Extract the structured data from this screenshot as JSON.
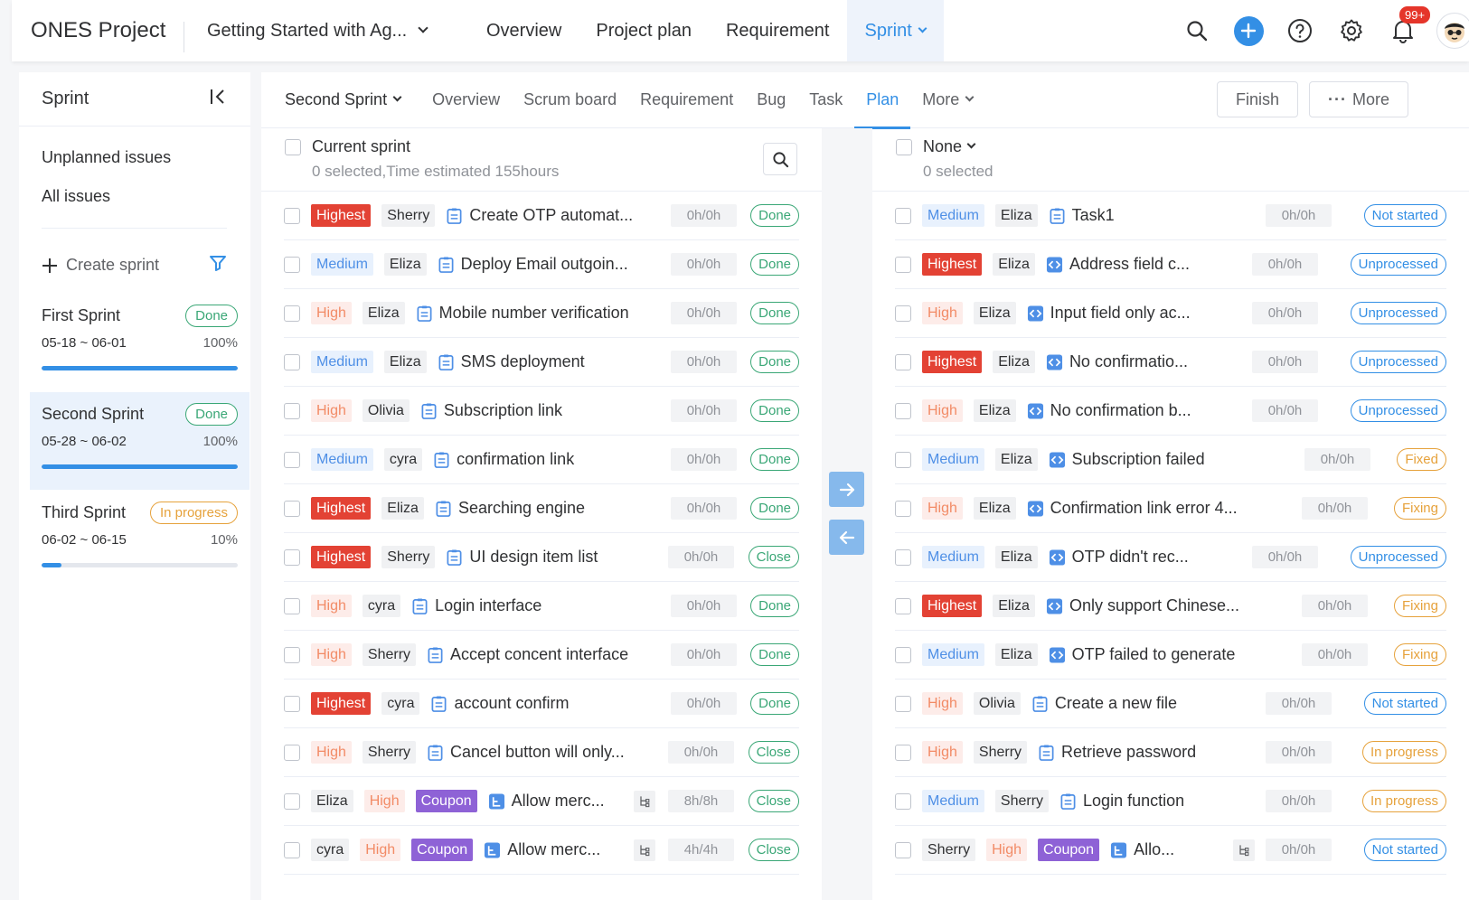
{
  "topbar": {
    "brand": "ONES Project",
    "project": "Getting Started with Ag...",
    "tabs": [
      "Overview",
      "Project plan",
      "Requirement",
      "Sprint"
    ],
    "notification_badge": "99+"
  },
  "sidebar": {
    "title": "Sprint",
    "links": [
      "Unplanned issues",
      "All issues"
    ],
    "create_label": "Create sprint",
    "sprints": [
      {
        "name": "First Sprint",
        "status": "Done",
        "dates": "05-18 ~ 06-01",
        "percent": "100%",
        "progress": 1.0
      },
      {
        "name": "Second Sprint",
        "status": "Done",
        "dates": "05-28 ~ 06-02",
        "percent": "100%",
        "progress": 1.0
      },
      {
        "name": "Third Sprint",
        "status": "In progress",
        "dates": "06-02 ~ 06-15",
        "percent": "10%",
        "progress": 0.1
      }
    ]
  },
  "subnav": {
    "sprint": "Second Sprint",
    "tabs": [
      "Overview",
      "Scrum board",
      "Requirement",
      "Bug",
      "Task",
      "Plan",
      "More"
    ],
    "finish": "Finish",
    "more": "More"
  },
  "left_panel": {
    "title": "Current sprint",
    "subtitle": "0 selected,Time estimated 155hours",
    "rows": [
      {
        "priority": "Highest",
        "assignee": "Sherry",
        "title": "Create OTP automat...",
        "hours": "0h/0h",
        "status": "Done"
      },
      {
        "priority": "Medium",
        "assignee": "Eliza",
        "title": "Deploy Email outgoin...",
        "hours": "0h/0h",
        "status": "Done"
      },
      {
        "priority": "High",
        "assignee": "Eliza",
        "title": "Mobile number verification",
        "hours": "0h/0h",
        "status": "Done"
      },
      {
        "priority": "Medium",
        "assignee": "Eliza",
        "title": "SMS deployment",
        "hours": "0h/0h",
        "status": "Done"
      },
      {
        "priority": "High",
        "assignee": "Olivia",
        "title": "Subscription link",
        "hours": "0h/0h",
        "status": "Done"
      },
      {
        "priority": "Medium",
        "assignee": "cyra",
        "title": "confirmation link",
        "hours": "0h/0h",
        "status": "Done"
      },
      {
        "priority": "Highest",
        "assignee": "Eliza",
        "title": "Searching engine",
        "hours": "0h/0h",
        "status": "Done"
      },
      {
        "priority": "Highest",
        "assignee": "Sherry",
        "title": "UI design item list",
        "hours": "0h/0h",
        "status": "Close"
      },
      {
        "priority": "High",
        "assignee": "cyra",
        "title": "Login interface",
        "hours": "0h/0h",
        "status": "Done"
      },
      {
        "priority": "High",
        "assignee": "Sherry",
        "title": "Accept concent interface",
        "hours": "0h/0h",
        "status": "Done"
      },
      {
        "priority": "Highest",
        "assignee": "cyra",
        "title": "account confirm",
        "hours": "0h/0h",
        "status": "Done"
      },
      {
        "priority": "High",
        "assignee": "Sherry",
        "title": "Cancel button will only...",
        "hours": "0h/0h",
        "status": "Close"
      },
      {
        "priority": "High",
        "assignee": "Eliza",
        "tag": "Coupon",
        "title": "Allow merc...",
        "hours": "8h/8h",
        "status": "Close"
      },
      {
        "priority": "High",
        "assignee": "cyra",
        "tag": "Coupon",
        "title": "Allow merc...",
        "hours": "4h/4h",
        "status": "Close"
      }
    ]
  },
  "right_panel": {
    "title": "None",
    "subtitle": "0 selected",
    "rows": [
      {
        "priority": "Medium",
        "assignee": "Eliza",
        "type": "task",
        "title": "Task1",
        "hours": "0h/0h",
        "status": "Not started"
      },
      {
        "priority": "Highest",
        "assignee": "Eliza",
        "type": "bug",
        "title": "Address field c...",
        "hours": "0h/0h",
        "status": "Unprocessed"
      },
      {
        "priority": "High",
        "assignee": "Eliza",
        "type": "bug",
        "title": "Input field only ac...",
        "hours": "0h/0h",
        "status": "Unprocessed"
      },
      {
        "priority": "Highest",
        "assignee": "Eliza",
        "type": "bug",
        "title": "No confirmatio...",
        "hours": "0h/0h",
        "status": "Unprocessed"
      },
      {
        "priority": "High",
        "assignee": "Eliza",
        "type": "bug",
        "title": "No confirmation b...",
        "hours": "0h/0h",
        "status": "Unprocessed"
      },
      {
        "priority": "Medium",
        "assignee": "Eliza",
        "type": "bug",
        "title": "Subscription failed",
        "hours": "0h/0h",
        "status": "Fixed"
      },
      {
        "priority": "High",
        "assignee": "Eliza",
        "type": "bug",
        "title": "Confirmation link error 4...",
        "hours": "0h/0h",
        "status": "Fixing"
      },
      {
        "priority": "Medium",
        "assignee": "Eliza",
        "type": "bug",
        "title": "OTP didn't rec...",
        "hours": "0h/0h",
        "status": "Unprocessed"
      },
      {
        "priority": "Highest",
        "assignee": "Eliza",
        "type": "bug",
        "title": "Only support Chinese...",
        "hours": "0h/0h",
        "status": "Fixing"
      },
      {
        "priority": "Medium",
        "assignee": "Eliza",
        "type": "bug",
        "title": "OTP failed to generate",
        "hours": "0h/0h",
        "status": "Fixing"
      },
      {
        "priority": "High",
        "assignee": "Olivia",
        "type": "task",
        "title": "Create a new file",
        "hours": "0h/0h",
        "status": "Not started"
      },
      {
        "priority": "High",
        "assignee": "Sherry",
        "type": "task",
        "title": "Retrieve password",
        "hours": "0h/0h",
        "status": "In progress"
      },
      {
        "priority": "Medium",
        "assignee": "Sherry",
        "type": "task",
        "title": "Login function",
        "hours": "0h/0h",
        "status": "In progress"
      },
      {
        "priority": "High",
        "assignee": "Sherry",
        "tag": "Coupon",
        "type": "story",
        "title": "Allo...",
        "hours": "0h/0h",
        "status": "Not started"
      }
    ]
  },
  "colors": {
    "accent": "#338fe5",
    "highest": "#e34234",
    "done": "#3aa776",
    "warning": "#e6a23c"
  }
}
